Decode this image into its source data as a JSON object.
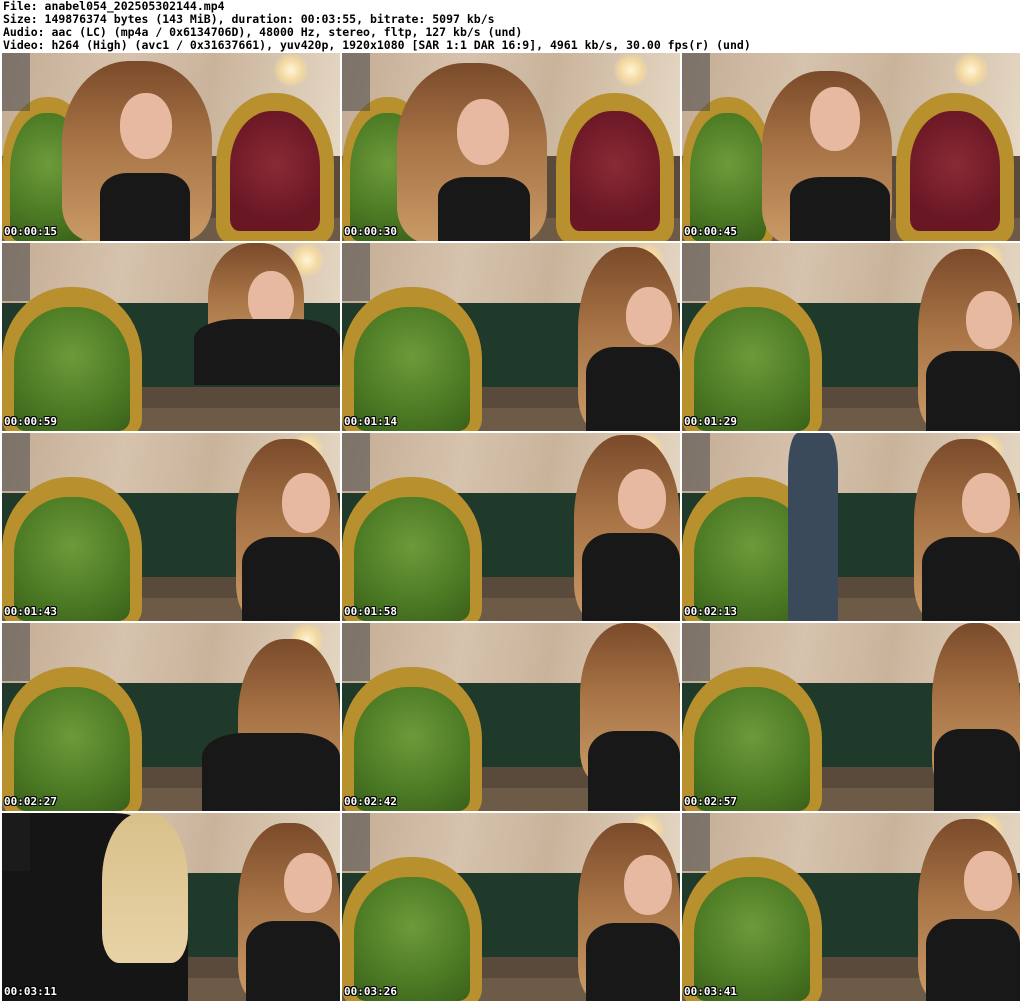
{
  "header": {
    "file_line": "File: anabel054_202505302144.mp4",
    "size_line": "Size: 149876374 bytes (143 MiB), duration: 00:03:55, bitrate: 5097 kb/s",
    "audio_line": "Audio: aac (LC) (mp4a / 0x6134706D), 48000 Hz, stereo, fltp, 127 kb/s (und)",
    "video_line": "Video: h264 (High) (avc1 / 0x31637661), yuv420p, 1920x1080 [SAR 1:1 DAR 16:9], 4961 kb/s, 30.00 fps(r) (und)"
  },
  "thumbnails": [
    {
      "timestamp": "00:00:15"
    },
    {
      "timestamp": "00:00:30"
    },
    {
      "timestamp": "00:00:45"
    },
    {
      "timestamp": "00:00:59"
    },
    {
      "timestamp": "00:01:14"
    },
    {
      "timestamp": "00:01:29"
    },
    {
      "timestamp": "00:01:43"
    },
    {
      "timestamp": "00:01:58"
    },
    {
      "timestamp": "00:02:13"
    },
    {
      "timestamp": "00:02:27"
    },
    {
      "timestamp": "00:02:42"
    },
    {
      "timestamp": "00:02:57"
    },
    {
      "timestamp": "00:03:11"
    },
    {
      "timestamp": "00:03:26"
    },
    {
      "timestamp": "00:03:41"
    }
  ]
}
